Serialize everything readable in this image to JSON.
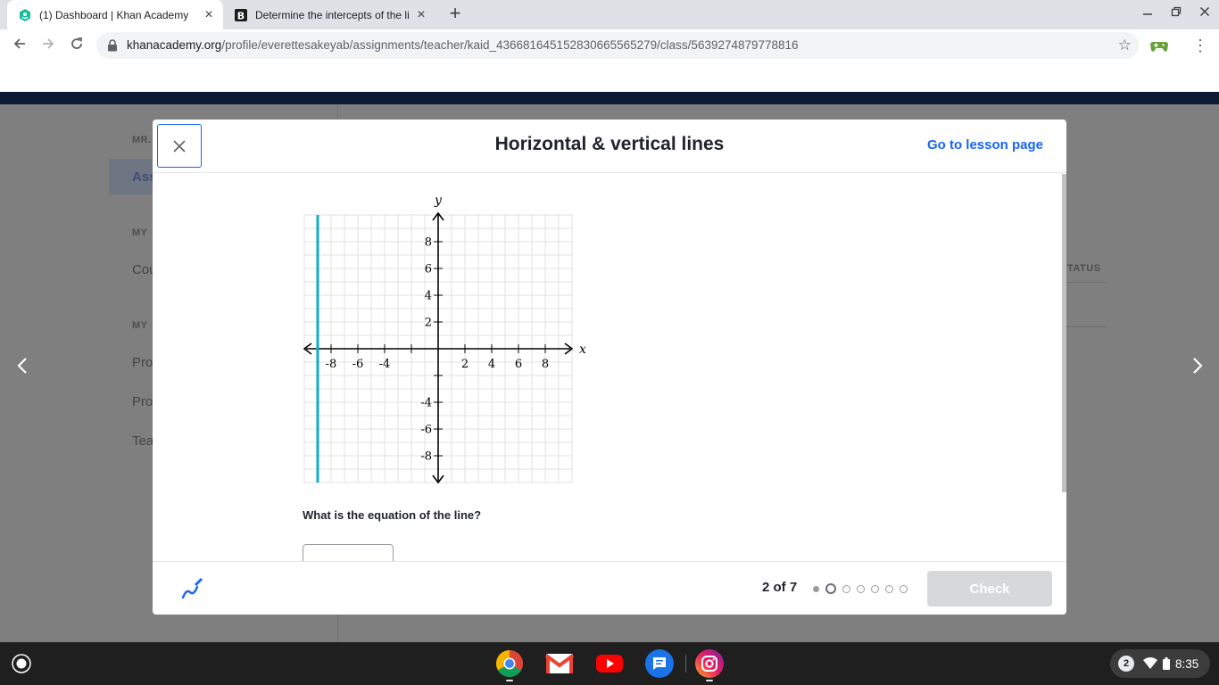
{
  "browser": {
    "tabs": [
      {
        "title": "(1) Dashboard | Khan Academy",
        "active": true
      },
      {
        "title": "Determine the intercepts of the li",
        "active": false
      }
    ],
    "url_domain": "khanacademy.org",
    "url_path": "/profile/everettesakeyab/assignments/teacher/kaid_436681645152830665565279/class/5639274879778816"
  },
  "background_page": {
    "sidebar_fragments": [
      "MR.",
      "Ass",
      "MY",
      "Cou",
      "MY",
      "Pro",
      "Pro",
      "Tea"
    ],
    "status_header": "TATUS"
  },
  "modal": {
    "title": "Horizontal & vertical lines",
    "lesson_link": "Go to lesson page",
    "question": "What is the equation of the line?",
    "answer_value": "",
    "progress": "2 of 7",
    "progress_current": 2,
    "progress_total": 7,
    "check_label": "Check"
  },
  "chart_data": {
    "type": "line",
    "xlabel": "x",
    "ylabel": "y",
    "xlim": [
      -10,
      10
    ],
    "ylim": [
      -10,
      10
    ],
    "x_ticks": [
      -8,
      -6,
      -4,
      2,
      4,
      6,
      8
    ],
    "y_ticks": [
      8,
      6,
      4,
      2,
      -4,
      -6,
      -8
    ],
    "grid": true,
    "series": [
      {
        "x": [
          -9,
          -9
        ],
        "y": [
          -10,
          10
        ]
      }
    ],
    "line_color": "#11accd"
  },
  "shelf": {
    "apps": [
      "chrome",
      "gmail",
      "youtube",
      "messages",
      "instagram"
    ],
    "notification_count": "2",
    "time": "8:35"
  }
}
